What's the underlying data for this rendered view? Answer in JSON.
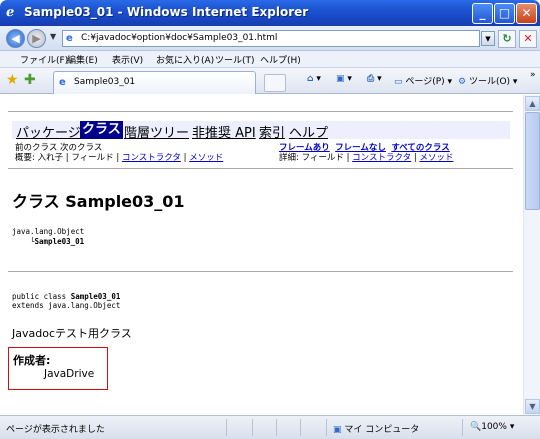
{
  "window": {
    "title": "Sample03_01 - Windows Internet Explorer",
    "controls": {
      "minimize": "_",
      "maximize": "□",
      "close": "✕"
    }
  },
  "address_bar": {
    "url": "C:¥javadoc¥option¥doc¥Sample03_01.html",
    "refresh": "↻",
    "stop": "✕"
  },
  "menu": {
    "items": [
      "ファイル(F)",
      "編集(E)",
      "表示(V)",
      "お気に入り(A)",
      "ツール(T)",
      "ヘルプ(H)"
    ]
  },
  "tabs": {
    "active_label": "Sample03_01"
  },
  "command_bar": {
    "page_label": "ページ(P)",
    "tools_label": "ツール(O)",
    "overflow": "»"
  },
  "javadoc": {
    "nav_top": {
      "package": "パッケージ",
      "class": "クラス",
      "tree": "階層ツリー",
      "deprecated": "非推奨 API",
      "index": "索引",
      "help": "ヘルプ"
    },
    "subnav": {
      "prev_class": "前のクラス",
      "next_class": "次のクラス",
      "summary_prefix": "概要: 入れ子 | フィールド | ",
      "constructor": "コンストラクタ",
      "sep": " | ",
      "method": "メソッド",
      "frames": "フレームあり",
      "no_frames": "フレームなし",
      "all_classes": "すべてのクラス",
      "detail_prefix": "詳細: フィールド | ",
      "detail_constructor": "コンストラクタ",
      "detail_method": "メソッド"
    },
    "class_title": "クラス Sample03_01",
    "hierarchy": {
      "parent": "java.lang.Object",
      "child_prefix": "└",
      "child": "Sample03_01"
    },
    "declaration": {
      "line1_prefix": "public class ",
      "line1_class": "Sample03_01",
      "line2": "extends java.lang.Object"
    },
    "description": "Javadocテスト用クラス",
    "author": {
      "label": "作成者:",
      "value": "JavaDrive"
    }
  },
  "status_bar": {
    "text": "ページが表示されました",
    "zone": "マイ コンピュータ",
    "zoom": "100%"
  }
}
